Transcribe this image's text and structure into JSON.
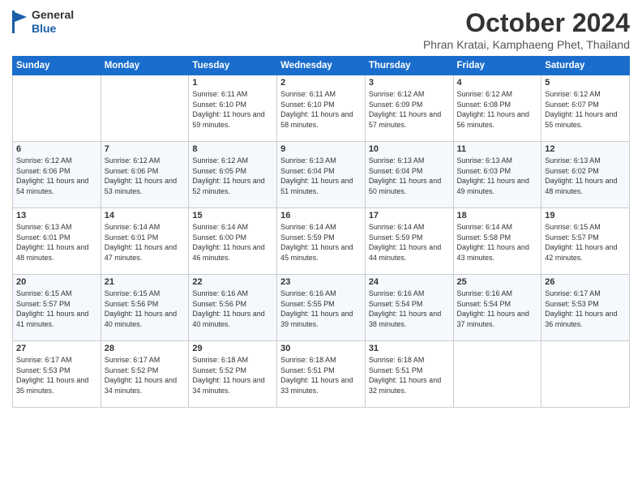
{
  "header": {
    "logo_line1": "General",
    "logo_line2": "Blue",
    "month": "October 2024",
    "location": "Phran Kratai, Kamphaeng Phet, Thailand"
  },
  "weekdays": [
    "Sunday",
    "Monday",
    "Tuesday",
    "Wednesday",
    "Thursday",
    "Friday",
    "Saturday"
  ],
  "weeks": [
    [
      {
        "day": "",
        "info": ""
      },
      {
        "day": "",
        "info": ""
      },
      {
        "day": "1",
        "info": "Sunrise: 6:11 AM\nSunset: 6:10 PM\nDaylight: 11 hours and 59 minutes."
      },
      {
        "day": "2",
        "info": "Sunrise: 6:11 AM\nSunset: 6:10 PM\nDaylight: 11 hours and 58 minutes."
      },
      {
        "day": "3",
        "info": "Sunrise: 6:12 AM\nSunset: 6:09 PM\nDaylight: 11 hours and 57 minutes."
      },
      {
        "day": "4",
        "info": "Sunrise: 6:12 AM\nSunset: 6:08 PM\nDaylight: 11 hours and 56 minutes."
      },
      {
        "day": "5",
        "info": "Sunrise: 6:12 AM\nSunset: 6:07 PM\nDaylight: 11 hours and 55 minutes."
      }
    ],
    [
      {
        "day": "6",
        "info": "Sunrise: 6:12 AM\nSunset: 6:06 PM\nDaylight: 11 hours and 54 minutes."
      },
      {
        "day": "7",
        "info": "Sunrise: 6:12 AM\nSunset: 6:06 PM\nDaylight: 11 hours and 53 minutes."
      },
      {
        "day": "8",
        "info": "Sunrise: 6:12 AM\nSunset: 6:05 PM\nDaylight: 11 hours and 52 minutes."
      },
      {
        "day": "9",
        "info": "Sunrise: 6:13 AM\nSunset: 6:04 PM\nDaylight: 11 hours and 51 minutes."
      },
      {
        "day": "10",
        "info": "Sunrise: 6:13 AM\nSunset: 6:04 PM\nDaylight: 11 hours and 50 minutes."
      },
      {
        "day": "11",
        "info": "Sunrise: 6:13 AM\nSunset: 6:03 PM\nDaylight: 11 hours and 49 minutes."
      },
      {
        "day": "12",
        "info": "Sunrise: 6:13 AM\nSunset: 6:02 PM\nDaylight: 11 hours and 48 minutes."
      }
    ],
    [
      {
        "day": "13",
        "info": "Sunrise: 6:13 AM\nSunset: 6:01 PM\nDaylight: 11 hours and 48 minutes."
      },
      {
        "day": "14",
        "info": "Sunrise: 6:14 AM\nSunset: 6:01 PM\nDaylight: 11 hours and 47 minutes."
      },
      {
        "day": "15",
        "info": "Sunrise: 6:14 AM\nSunset: 6:00 PM\nDaylight: 11 hours and 46 minutes."
      },
      {
        "day": "16",
        "info": "Sunrise: 6:14 AM\nSunset: 5:59 PM\nDaylight: 11 hours and 45 minutes."
      },
      {
        "day": "17",
        "info": "Sunrise: 6:14 AM\nSunset: 5:59 PM\nDaylight: 11 hours and 44 minutes."
      },
      {
        "day": "18",
        "info": "Sunrise: 6:14 AM\nSunset: 5:58 PM\nDaylight: 11 hours and 43 minutes."
      },
      {
        "day": "19",
        "info": "Sunrise: 6:15 AM\nSunset: 5:57 PM\nDaylight: 11 hours and 42 minutes."
      }
    ],
    [
      {
        "day": "20",
        "info": "Sunrise: 6:15 AM\nSunset: 5:57 PM\nDaylight: 11 hours and 41 minutes."
      },
      {
        "day": "21",
        "info": "Sunrise: 6:15 AM\nSunset: 5:56 PM\nDaylight: 11 hours and 40 minutes."
      },
      {
        "day": "22",
        "info": "Sunrise: 6:16 AM\nSunset: 5:56 PM\nDaylight: 11 hours and 40 minutes."
      },
      {
        "day": "23",
        "info": "Sunrise: 6:16 AM\nSunset: 5:55 PM\nDaylight: 11 hours and 39 minutes."
      },
      {
        "day": "24",
        "info": "Sunrise: 6:16 AM\nSunset: 5:54 PM\nDaylight: 11 hours and 38 minutes."
      },
      {
        "day": "25",
        "info": "Sunrise: 6:16 AM\nSunset: 5:54 PM\nDaylight: 11 hours and 37 minutes."
      },
      {
        "day": "26",
        "info": "Sunrise: 6:17 AM\nSunset: 5:53 PM\nDaylight: 11 hours and 36 minutes."
      }
    ],
    [
      {
        "day": "27",
        "info": "Sunrise: 6:17 AM\nSunset: 5:53 PM\nDaylight: 11 hours and 35 minutes."
      },
      {
        "day": "28",
        "info": "Sunrise: 6:17 AM\nSunset: 5:52 PM\nDaylight: 11 hours and 34 minutes."
      },
      {
        "day": "29",
        "info": "Sunrise: 6:18 AM\nSunset: 5:52 PM\nDaylight: 11 hours and 34 minutes."
      },
      {
        "day": "30",
        "info": "Sunrise: 6:18 AM\nSunset: 5:51 PM\nDaylight: 11 hours and 33 minutes."
      },
      {
        "day": "31",
        "info": "Sunrise: 6:18 AM\nSunset: 5:51 PM\nDaylight: 11 hours and 32 minutes."
      },
      {
        "day": "",
        "info": ""
      },
      {
        "day": "",
        "info": ""
      }
    ]
  ]
}
